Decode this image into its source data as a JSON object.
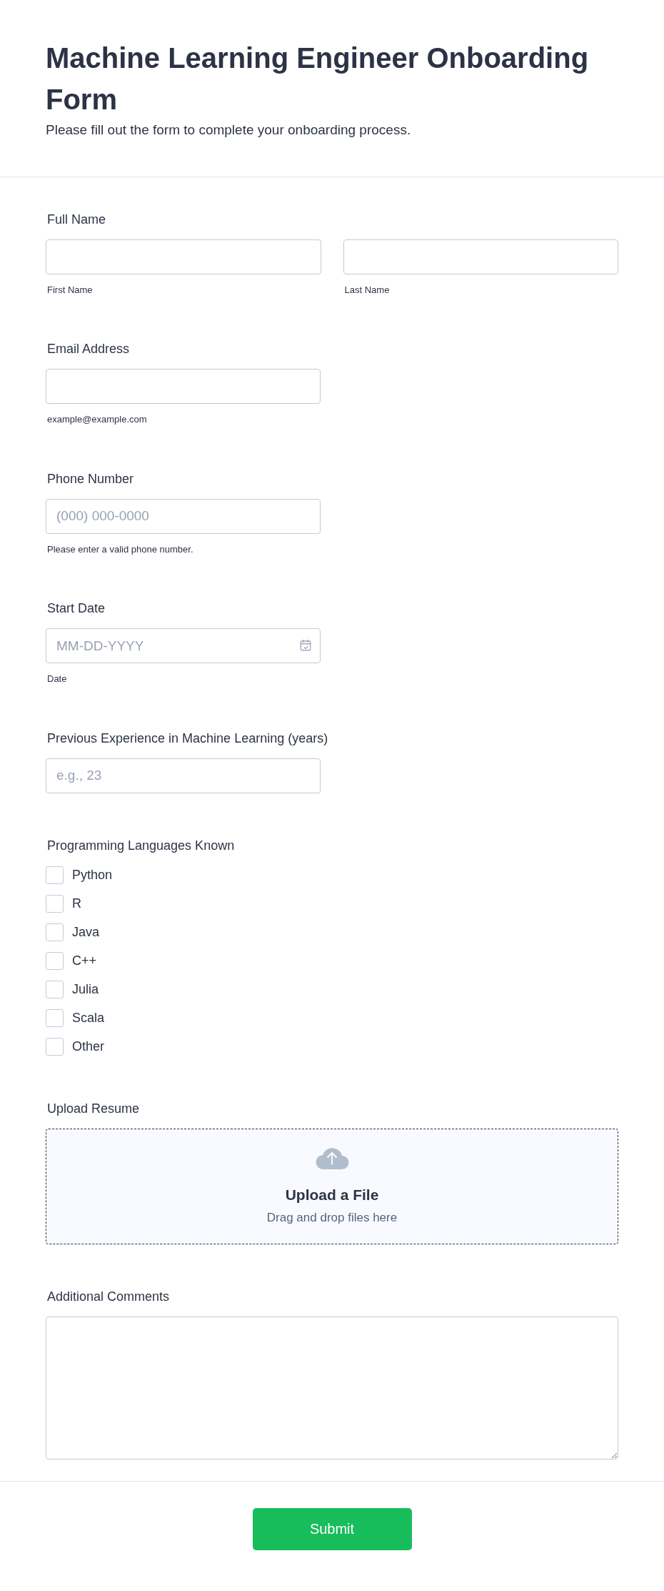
{
  "header": {
    "title": "Machine Learning Engineer Onboarding Form",
    "subtitle": "Please fill out the form to complete your onboarding process."
  },
  "fields": [
    {
      "kind": "name",
      "label": "Full Name",
      "parts": [
        {
          "sublabel": "First Name"
        },
        {
          "sublabel": "Last Name"
        }
      ]
    },
    {
      "kind": "text",
      "label": "Email Address",
      "sublabel": "example@example.com"
    },
    {
      "kind": "text",
      "label": "Phone Number",
      "placeholder": "(000) 000-0000",
      "sublabel": "Please enter a valid phone number."
    },
    {
      "kind": "date",
      "label": "Start Date",
      "placeholder": "MM-DD-YYYY",
      "sublabel": "Date"
    },
    {
      "kind": "text",
      "label": "Previous Experience in Machine Learning (years)",
      "placeholder": "e.g., 23"
    },
    {
      "kind": "checkboxes",
      "label": "Programming Languages Known",
      "options": [
        {
          "label": "Python",
          "checked": false
        },
        {
          "label": "R",
          "checked": false
        },
        {
          "label": "Java",
          "checked": false
        },
        {
          "label": "C++",
          "checked": false
        },
        {
          "label": "Julia",
          "checked": false
        },
        {
          "label": "Scala",
          "checked": false
        },
        {
          "label": "Other",
          "checked": false
        }
      ]
    },
    {
      "kind": "upload",
      "label": "Upload Resume",
      "title": "Upload a File",
      "hint": "Drag and drop files here"
    },
    {
      "kind": "textarea",
      "label": "Additional Comments"
    }
  ],
  "submit": "Submit"
}
